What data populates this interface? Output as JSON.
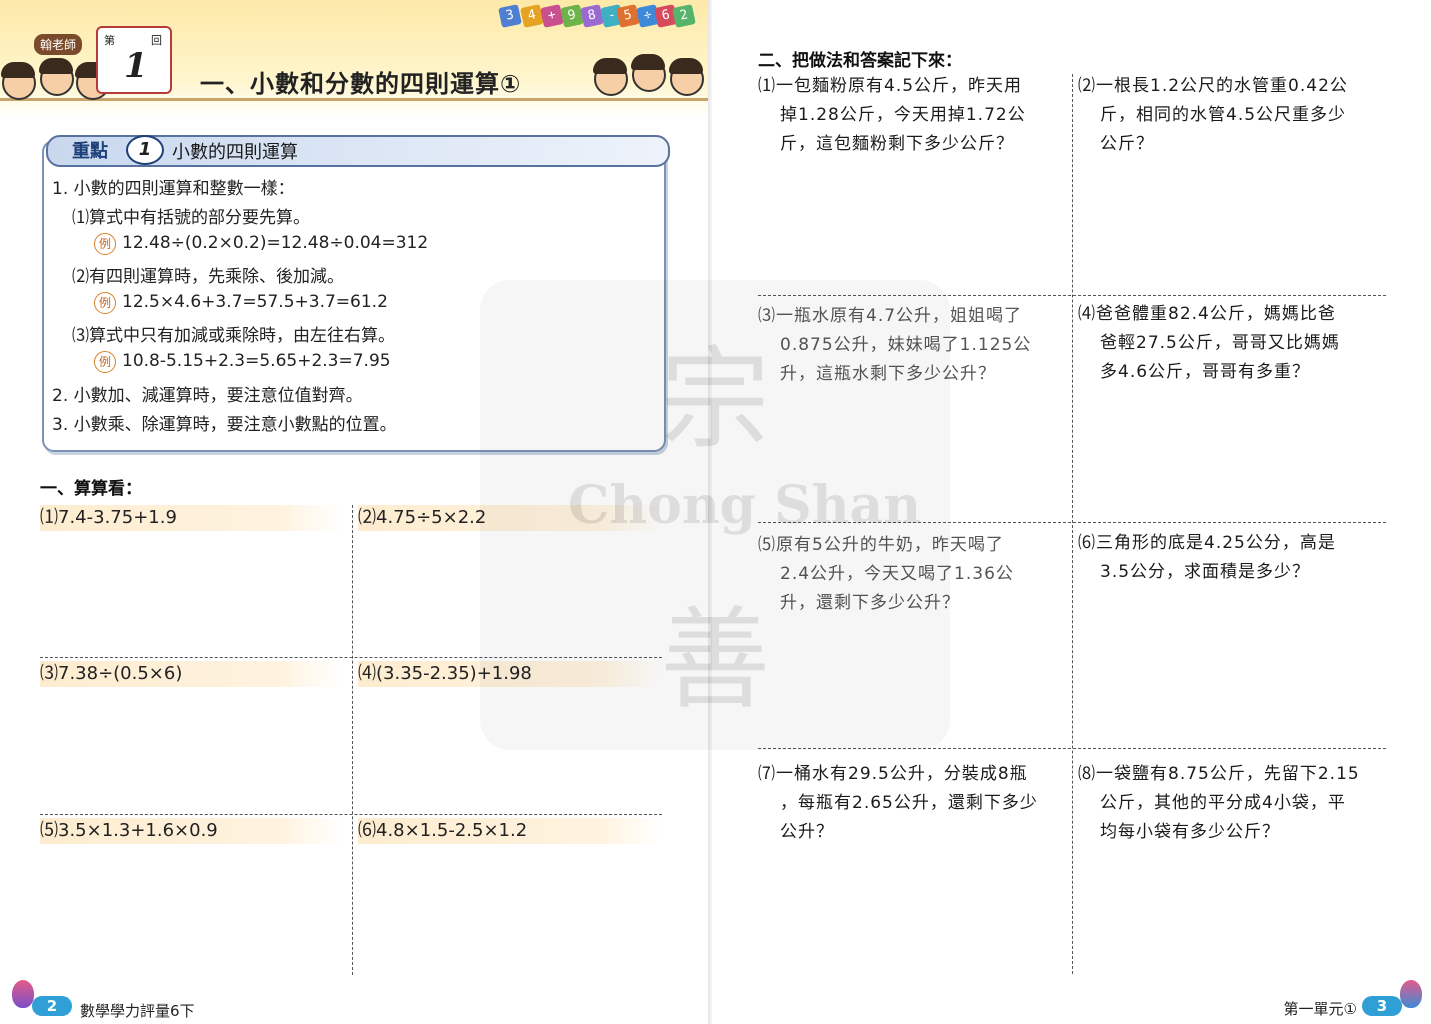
{
  "left": {
    "teacher_tag": "翰老師",
    "lesson_card": {
      "prefix": "第",
      "number": "1",
      "suffix": "回"
    },
    "title": "一、小數和分數的四則運算①",
    "number_tiles": [
      "3",
      "4",
      "+",
      "9",
      "8",
      "-",
      "5",
      "÷",
      "6",
      "2"
    ],
    "key": {
      "label": "重點",
      "number": "1",
      "title": "小數的四則運算",
      "lines": [
        "1. 小數的四則運算和整數一樣：",
        "⑴算式中有括號的部分要先算。",
        "12.48÷(0.2×0.2)=12.48÷0.04=312",
        "⑵有四則運算時，先乘除、後加減。",
        "12.5×4.6+3.7=57.5+3.7=61.2",
        "⑶算式中只有加減或乘除時，由左往右算。",
        "10.8-5.15+2.3=5.65+2.3=7.95",
        "2. 小數加、減運算時，要注意位值對齊。",
        "3. 小數乘、除運算時，要注意小數點的位置。"
      ],
      "example_mark": "例"
    },
    "section1_title": "一、算算看：",
    "exercises": [
      "⑴7.4-3.75+1.9",
      "⑵4.75÷5×2.2",
      "⑶7.38÷(0.5×6)",
      "⑷(3.35-2.35)+1.98",
      "⑸3.5×1.3+1.6×0.9",
      "⑹4.8×1.5-2.5×1.2"
    ],
    "footer": {
      "page": "2",
      "book": "數學學力評量6下"
    }
  },
  "right": {
    "section2_title": "二、把做法和答案記下來：",
    "problems": [
      {
        "no": "⑴",
        "lines": [
          "一包麵粉原有4.5公斤，昨天用",
          "掉1.28公斤，今天用掉1.72公",
          "斤，這包麵粉剩下多少公斤？"
        ]
      },
      {
        "no": "⑵",
        "lines": [
          "一根長1.2公尺的水管重0.42公",
          "斤，相同的水管4.5公尺重多少",
          "公斤？"
        ]
      },
      {
        "no": "⑶",
        "lines": [
          "一瓶水原有4.7公升，姐姐喝了",
          "0.875公升，妹妹喝了1.125公",
          "升，這瓶水剩下多少公升？"
        ]
      },
      {
        "no": "⑷",
        "lines": [
          "爸爸體重82.4公斤，媽媽比爸",
          "爸輕27.5公斤，哥哥又比媽媽",
          "多4.6公斤，哥哥有多重？"
        ]
      },
      {
        "no": "⑸",
        "lines": [
          "原有5公升的牛奶，昨天喝了",
          "2.4公升，今天又喝了1.36公",
          "升，還剩下多少公升？"
        ]
      },
      {
        "no": "⑹",
        "lines": [
          "三角形的底是4.25公分，高是",
          "3.5公分，求面積是多少？"
        ]
      },
      {
        "no": "⑺",
        "lines": [
          "一桶水有29.5公升，分裝成8瓶",
          "，每瓶有2.65公升，還剩下多少",
          "公升？"
        ]
      },
      {
        "no": "⑻",
        "lines": [
          "一袋鹽有8.75公斤，先留下2.15",
          "公斤，其他的平分成4小袋，平",
          "均每小袋有多少公斤？"
        ]
      }
    ],
    "footer": {
      "unit": "第一單元①",
      "page": "3"
    }
  },
  "watermark": {
    "top_char": "宗",
    "latin": "Chong Shan",
    "bottom_char": "善"
  },
  "colors": {
    "accent_blue": "#2f9fd6",
    "key_border": "#7b93b5",
    "strip": "#fdeccf",
    "header": "#fde9a8"
  }
}
